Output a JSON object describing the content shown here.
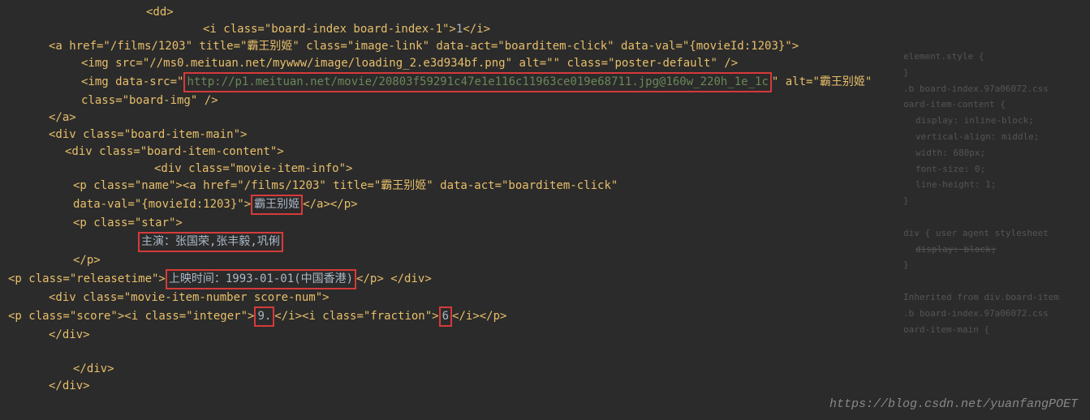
{
  "code": {
    "dd_tag": "<dd>",
    "board_index_open": "<i class=\"board-index board-index-1\">",
    "board_index_value": "1",
    "board_index_close": "</i>",
    "a_link_open": "<a href=\"/films/1203\" title=\"霸王别姬\" class=\"image-link\" data-act=\"boarditem-click\" data-val=\"{movieId:1203}\">",
    "img1": "<img src=\"//ms0.meituan.net/mywww/image/loading_2.e3d934bf.png\" alt=\"\" class=\"poster-default\" />",
    "img2_open": "<img data-src=\"",
    "img2_url": "http://p1.meituan.net/movie/20803f59291c47e1e116c11963ce019e68711.jpg@160w_220h_1e_1c",
    "img2_close": "\" alt=\"霸王别姬\"",
    "img2_line2": "class=\"board-img\" />",
    "a_close": "</a>",
    "div_bim": "<div class=\"board-item-main\">",
    "div_bic": "<div class=\"board-item-content\">",
    "div_mii": "<div class=\"movie-item-info\">",
    "p_name_open": "<p class=\"name\"><a href=\"/films/1203\" title=\"霸王别姬\" data-act=\"boarditem-click\"",
    "p_name_dataval": "data-val=\"{movieId:1203}\">",
    "movie_title": "霸王别姬",
    "p_name_close": "</a></p>",
    "p_star_open": "<p class=\"star\">",
    "star_text": "主演：张国荣,张丰毅,巩俐",
    "p_close": "</p>",
    "p_release_open": "<p class=\"releasetime\">",
    "release_text": "上映时间：1993-01-01(中国香港)",
    "p_release_close": "</p>",
    "div_close_inline": "</div>",
    "div_minsn": "<div class=\"movie-item-number score-num\">",
    "p_score_open": "<p class=\"score\"><i class=\"integer\">",
    "score_int": "9.",
    "p_score_mid": "</i><i class=\"fraction\">",
    "score_frac": "6",
    "p_score_close": "</i></p>",
    "div_close": "</div>"
  },
  "right_panel": {
    "l1": "element.style {",
    "l2": "}",
    "l3": ".b board-index.97a06072.css",
    "l4": "oard-item-content {",
    "l5": "display: inline-block;",
    "l6": "vertical-align: middle;",
    "l7": "width: 680px;",
    "l8": "font-size: 0;",
    "l9": "line-height: 1;",
    "l10": "}",
    "l11": "div {    user agent stylesheet",
    "l12": "display: block;",
    "l13": "}",
    "l14": "Inherited from div.board-item",
    "l15": ".b board-index.97a06072.css",
    "l16": "oard-item-main {"
  },
  "watermark": "https://blog.csdn.net/yuanfangPOET"
}
